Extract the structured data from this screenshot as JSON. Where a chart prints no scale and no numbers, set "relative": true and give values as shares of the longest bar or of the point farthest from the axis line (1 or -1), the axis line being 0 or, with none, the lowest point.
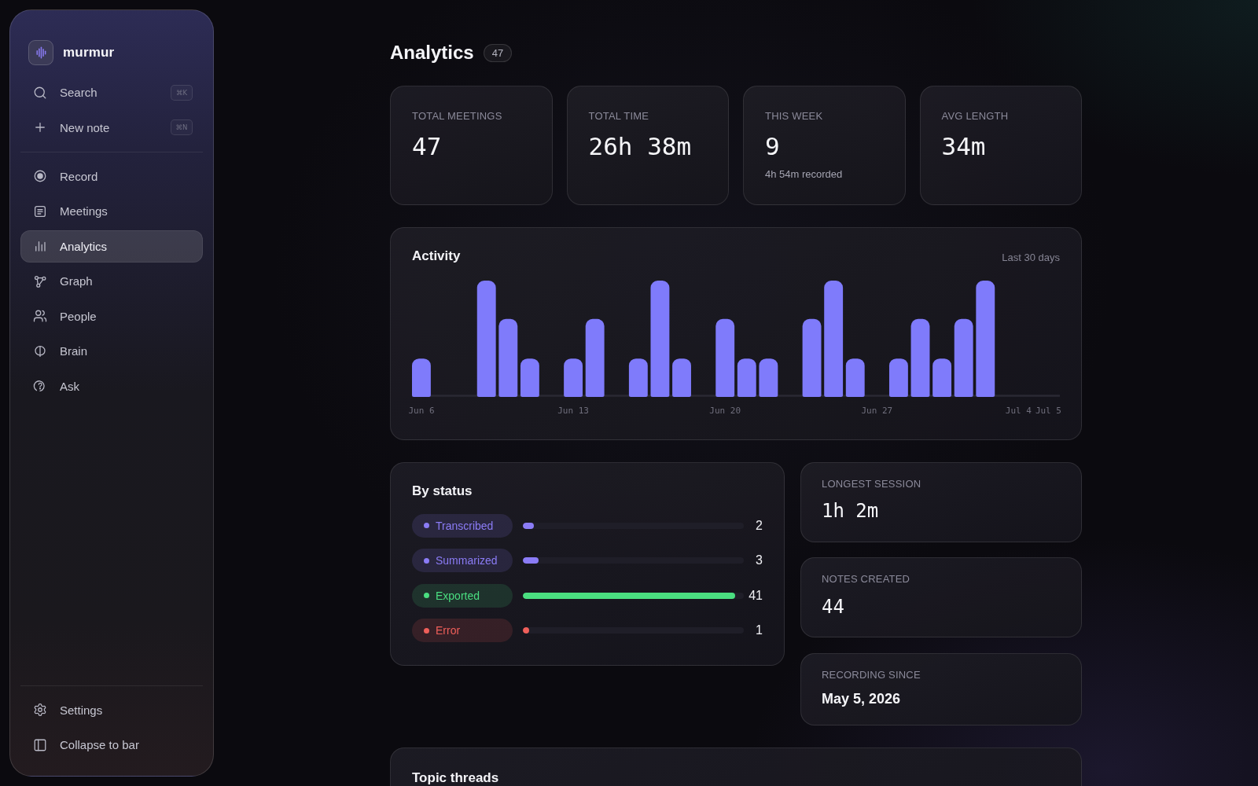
{
  "sidebar": {
    "brand": "murmur",
    "actions": [
      {
        "label": "Search",
        "shortcut": "⌘K",
        "kind": "search"
      },
      {
        "label": "New note",
        "shortcut": "⌘N",
        "kind": "new"
      }
    ],
    "items": [
      {
        "label": "Record",
        "kind": "record",
        "selected": false
      },
      {
        "label": "Meetings",
        "kind": "meetings",
        "selected": false
      },
      {
        "label": "Analytics",
        "kind": "analytics",
        "selected": true
      },
      {
        "label": "Graph",
        "kind": "graph",
        "selected": false
      },
      {
        "label": "People",
        "kind": "people",
        "selected": false
      },
      {
        "label": "Brain",
        "kind": "brain",
        "selected": false
      },
      {
        "label": "Ask",
        "kind": "ask",
        "selected": false
      }
    ],
    "footer": [
      {
        "label": "Settings",
        "kind": "settings"
      },
      {
        "label": "Collapse to bar",
        "kind": "collapse"
      }
    ]
  },
  "page": {
    "title": "Analytics",
    "count": "47"
  },
  "stats": [
    {
      "label": "TOTAL MEETINGS",
      "value": "47"
    },
    {
      "label": "TOTAL TIME",
      "value": "26h 38m"
    },
    {
      "label": "THIS WEEK",
      "value": "9",
      "note": "4h 54m recorded"
    },
    {
      "label": "AVG LENGTH",
      "value": "34m"
    }
  ],
  "activity": {
    "title": "Activity",
    "range": "Last 30 days",
    "chart_data": {
      "type": "bar",
      "relative": true,
      "categories": [
        "Jun 6",
        null,
        null,
        null,
        null,
        null,
        null,
        "Jun 13",
        null,
        null,
        null,
        null,
        null,
        null,
        "Jun 20",
        null,
        null,
        null,
        null,
        null,
        null,
        "Jun 27",
        null,
        null,
        null,
        null,
        null,
        null,
        "Jul 4",
        "Jul 5"
      ],
      "values": [
        0.33,
        0,
        0,
        1,
        0.67,
        0.33,
        0,
        0.33,
        0.67,
        0,
        0.33,
        1,
        0.33,
        0,
        0.67,
        0.33,
        0.33,
        0,
        0.67,
        1,
        0.33,
        0,
        0.33,
        0.67,
        0.33,
        0.67,
        1,
        0,
        0,
        0
      ],
      "color": "#7f7bfb"
    }
  },
  "by_status": {
    "title": "By status",
    "rows": [
      {
        "label": "Transcribed",
        "color": "#8b7cf6",
        "level": 0.05,
        "count": "2"
      },
      {
        "label": "Summarized",
        "color": "#8b7cf6",
        "level": 0.07,
        "count": "3"
      },
      {
        "label": "Exported",
        "color": "#4ade80",
        "level": 0.96,
        "count": "41"
      },
      {
        "label": "Error",
        "color": "#ef5f5a",
        "level": 0.03,
        "count": "1"
      }
    ]
  },
  "highlights": [
    {
      "label": "LONGEST SESSION",
      "value": "1h 2m",
      "kind": "number"
    },
    {
      "label": "NOTES CREATED",
      "value": "44",
      "kind": "number"
    },
    {
      "label": "RECORDING SINCE",
      "value": "May 5, 2026",
      "kind": "date"
    }
  ],
  "topics": {
    "title": "Topic threads"
  }
}
